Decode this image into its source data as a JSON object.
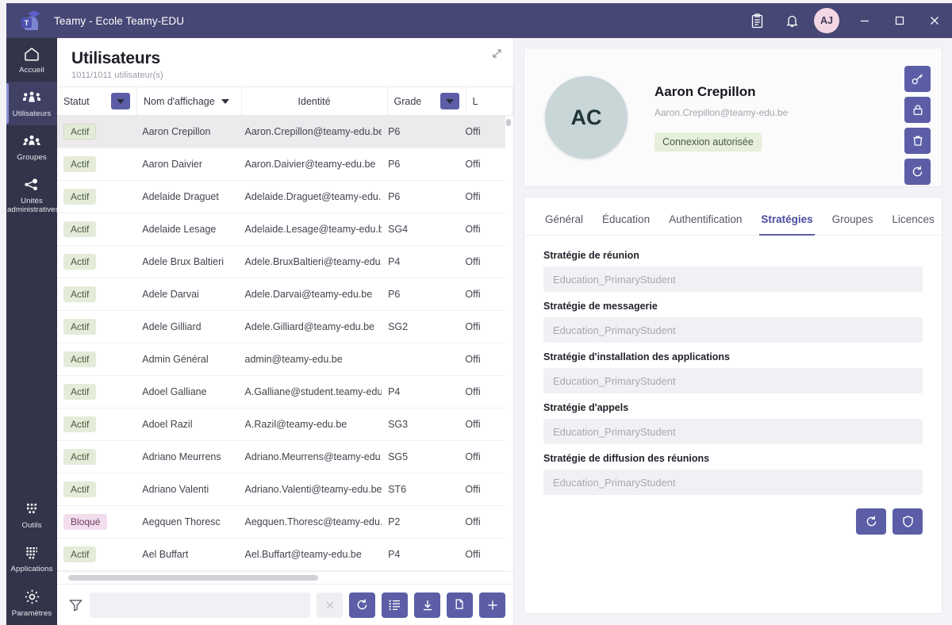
{
  "titlebar": {
    "logo_letter": "T",
    "title": "Teamy - Ecole Teamy-EDU",
    "clipboard_icon": "clipboard-icon",
    "bell_icon": "bell-icon",
    "avatar_initials": "AJ",
    "minimize_label": "—",
    "maximize_label": "□",
    "close_label": "×"
  },
  "rail": {
    "top_items": [
      {
        "label": "Accueil",
        "icon": "home-icon",
        "active": false
      },
      {
        "label": "Utilisateurs",
        "icon": "users-icon",
        "active": true
      },
      {
        "label": "Groupes",
        "icon": "group-icon",
        "active": false
      },
      {
        "label": "Unités administratives",
        "icon": "org-units-icon",
        "active": false
      }
    ],
    "bottom_items": [
      {
        "label": "Outils",
        "icon": "grid-icon",
        "active": false
      },
      {
        "label": "Applications",
        "icon": "apps-grid-icon",
        "active": false
      },
      {
        "label": "Paramètres",
        "icon": "gear-icon",
        "active": false
      }
    ]
  },
  "users_panel": {
    "title": "Utilisateurs",
    "subtitle": "1011/1011 utilisateur(s)",
    "expand_icon": "expand-diagonal-icon",
    "columns": [
      {
        "key": "statut",
        "label": "Statut",
        "has_filter": true,
        "has_sort": false
      },
      {
        "key": "nom",
        "label": "Nom d'affichage",
        "has_filter": false,
        "has_sort": true
      },
      {
        "key": "identite",
        "label": "Identité",
        "has_filter": false,
        "has_sort": false
      },
      {
        "key": "grade",
        "label": "Grade",
        "has_filter": true,
        "has_sort": false
      },
      {
        "key": "licence",
        "label": "L",
        "has_filter": false,
        "has_sort": false
      }
    ],
    "rows": [
      {
        "statut": "Actif",
        "nom": "Aaron Crepillon",
        "identite": "Aaron.Crepillon@teamy-edu.be",
        "grade": "P6",
        "licence": "Offi",
        "selected": true
      },
      {
        "statut": "Actif",
        "nom": "Aaron Daivier",
        "identite": "Aaron.Daivier@teamy-edu.be",
        "grade": "P6",
        "licence": "Offi",
        "selected": false
      },
      {
        "statut": "Actif",
        "nom": "Adelaide Draguet",
        "identite": "Adelaide.Draguet@teamy-edu.be",
        "grade": "P6",
        "licence": "Offi",
        "selected": false
      },
      {
        "statut": "Actif",
        "nom": "Adelaide Lesage",
        "identite": "Adelaide.Lesage@teamy-edu.be",
        "grade": "SG4",
        "licence": "Offi",
        "selected": false
      },
      {
        "statut": "Actif",
        "nom": "Adele Brux Baltieri",
        "identite": "Adele.BruxBaltieri@teamy-edu.be",
        "grade": "P4",
        "licence": "Offi",
        "selected": false
      },
      {
        "statut": "Actif",
        "nom": "Adele Darvai",
        "identite": "Adele.Darvai@teamy-edu.be",
        "grade": "P6",
        "licence": "Offi",
        "selected": false
      },
      {
        "statut": "Actif",
        "nom": "Adele Gilliard",
        "identite": "Adele.Gilliard@teamy-edu.be",
        "grade": "SG2",
        "licence": "Offi",
        "selected": false
      },
      {
        "statut": "Actif",
        "nom": "Admin Général",
        "identite": "admin@teamy-edu.be",
        "grade": "",
        "licence": "Offi",
        "selected": false
      },
      {
        "statut": "Actif",
        "nom": "Adoel Galliane",
        "identite": "A.Galliane@student.teamy-edu.be",
        "grade": "P4",
        "licence": "Offi",
        "selected": false
      },
      {
        "statut": "Actif",
        "nom": "Adoel Razil",
        "identite": "A.Razil@teamy-edu.be",
        "grade": "SG3",
        "licence": "Offi",
        "selected": false
      },
      {
        "statut": "Actif",
        "nom": "Adriano Meurrens",
        "identite": "Adriano.Meurrens@teamy-edu.be",
        "grade": "SG5",
        "licence": "Offi",
        "selected": false
      },
      {
        "statut": "Actif",
        "nom": "Adriano Valenti",
        "identite": "Adriano.Valenti@teamy-edu.be",
        "grade": "ST6",
        "licence": "Offi",
        "selected": false
      },
      {
        "statut": "Bloqué",
        "nom": "Aegquen Thoresc",
        "identite": "Aegquen.Thoresc@teamy-edu.be",
        "grade": "P2",
        "licence": "Offi",
        "selected": false
      },
      {
        "statut": "Actif",
        "nom": "Ael Buffart",
        "identite": "Ael.Buffart@teamy-edu.be",
        "grade": "P4",
        "licence": "Offi",
        "selected": false
      }
    ],
    "toolbar": {
      "filter_icon": "funnel-icon",
      "search_value": "",
      "search_placeholder": "",
      "clear_icon": "close-icon",
      "refresh_icon": "refresh-icon",
      "list_icon": "list-icon",
      "download_icon": "download-icon",
      "copy_icon": "copy-icon",
      "add_icon": "plus-icon"
    }
  },
  "detail": {
    "avatar_initials": "AC",
    "name": "Aaron Crepillon",
    "email": "Aaron.Crepillon@teamy-edu.be",
    "status_badge": "Connexion autorisée",
    "actions": [
      {
        "icon": "key-icon",
        "name": "reset-password-button"
      },
      {
        "icon": "lock-icon",
        "name": "block-account-button"
      },
      {
        "icon": "trash-icon",
        "name": "delete-user-button"
      },
      {
        "icon": "refresh-icon",
        "name": "refresh-user-button"
      }
    ],
    "tabs": [
      {
        "label": "Général",
        "active": false
      },
      {
        "label": "Éducation",
        "active": false
      },
      {
        "label": "Authentification",
        "active": false
      },
      {
        "label": "Stratégies",
        "active": true
      },
      {
        "label": "Groupes",
        "active": false
      },
      {
        "label": "Licences",
        "active": false
      }
    ],
    "fields": [
      {
        "label": "Stratégie de réunion",
        "value": "Education_PrimaryStudent"
      },
      {
        "label": "Stratégie de messagerie",
        "value": "Education_PrimaryStudent"
      },
      {
        "label": "Stratégie d'installation des applications",
        "value": "Education_PrimaryStudent"
      },
      {
        "label": "Stratégie d'appels",
        "value": "Education_PrimaryStudent"
      },
      {
        "label": "Stratégie de diffusion des réunions",
        "value": "Education_PrimaryStudent"
      }
    ],
    "form_actions": [
      {
        "icon": "refresh-icon",
        "name": "reload-policies-button"
      },
      {
        "icon": "shield-icon",
        "name": "apply-policies-button"
      }
    ]
  },
  "colors": {
    "titlebar": "#464775",
    "rail": "#33344a",
    "accent": "#5b5ea6",
    "tab_active": "#4b4ca0",
    "badge_active_bg": "#e4ecd9",
    "badge_blocked_bg": "#f2dded"
  }
}
